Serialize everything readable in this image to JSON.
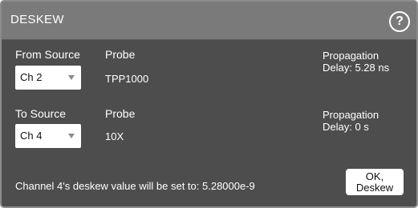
{
  "dialog": {
    "title": "DESKEW",
    "help_glyph": "?",
    "help_icon": "help-circle-icon"
  },
  "from": {
    "label": "From Source",
    "selected": "Ch 2",
    "probe_label": "Probe",
    "probe_value": "TPP1000",
    "propagation_line1": "Propagation",
    "propagation_line2": "Delay: 5.28 ns"
  },
  "to": {
    "label": "To Source",
    "selected": "Ch 4",
    "probe_label": "Probe",
    "probe_value": "10X",
    "propagation_line1": "Propagation",
    "propagation_line2": "Delay: 0 s"
  },
  "status_text": "Channel 4's deskew value will be set to: 5.28000e-9",
  "ok_button": {
    "line1": "OK,",
    "line2": "Deskew"
  },
  "colors": {
    "background": "#4d4d4d",
    "titlebar": "#7a7a7a",
    "text": "#ffffff",
    "button": "#ffffff"
  }
}
